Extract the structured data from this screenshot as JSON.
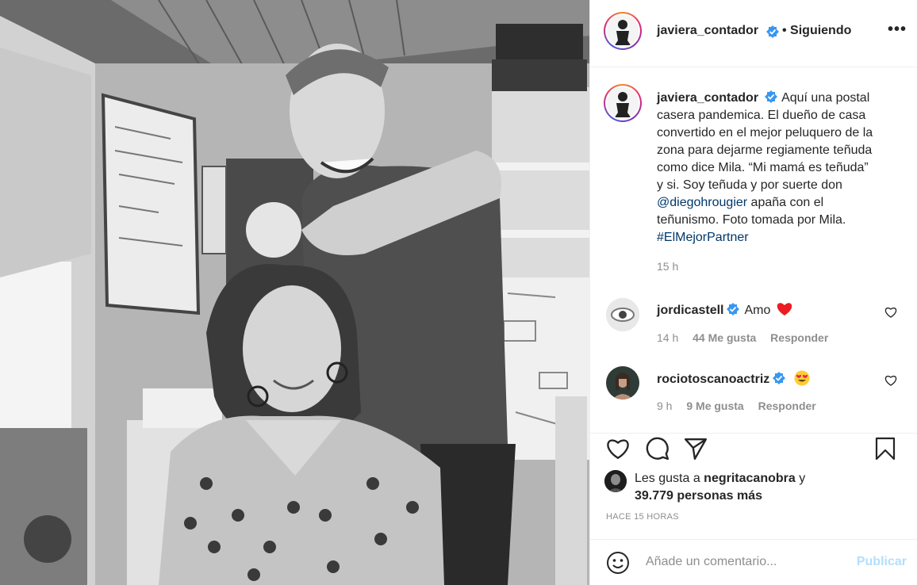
{
  "post": {
    "author": "javiera_contador",
    "follow_status": "• Siguiendo",
    "more_icon": "•••",
    "caption_lines": [
      "Aquí una postal",
      "casera pandemica. El dueño de casa",
      "convertido en el mejor peluquero de la",
      "zona para dejarme regiamente teñuda",
      "como dice Mila. “Mi mamá es teñuda”",
      "y si. Soy teñuda y por suerte don"
    ],
    "caption_mention": "@diegohrougier",
    "caption_after_mention": " apaña con el",
    "caption_line_8": "teñunismo. Foto tomada por Mila.",
    "caption_hashtag": "#ElMejorPartner",
    "caption_time": "15 h"
  },
  "comments": [
    {
      "user": "jordicastell",
      "text": "Amo",
      "emoji": "❤️",
      "time": "14 h",
      "likes": "44 Me gusta",
      "reply": "Responder"
    },
    {
      "user": "rociotoscanoactriz",
      "text": "",
      "emoji": "😍",
      "time": "9 h",
      "likes": "9 Me gusta",
      "reply": "Responder"
    }
  ],
  "likes": {
    "prefix": "Les gusta a ",
    "user": "negritacanobra",
    "middle": " y",
    "count_text": "39.779 personas más"
  },
  "time_ago": "HACE 15 HORAS",
  "comment_box": {
    "placeholder": "Añade un comentario...",
    "publish_label": "Publicar"
  },
  "icons": {
    "verified": "verified-badge-icon",
    "like": "heart-icon",
    "comment": "comment-bubble-icon",
    "share": "paper-plane-icon",
    "save": "bookmark-icon",
    "emoji": "smiley-icon"
  },
  "colors": {
    "verified": "#3897f0",
    "link": "#00376b",
    "publish_disabled": "#b2dffc",
    "heart_red": "#ed4956"
  }
}
